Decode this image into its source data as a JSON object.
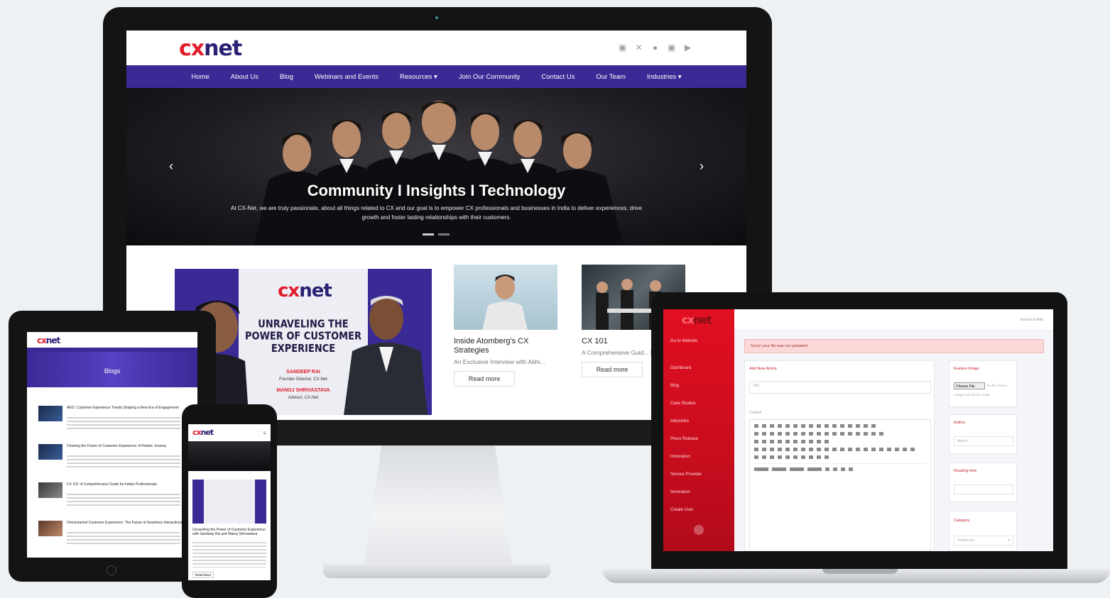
{
  "brand": {
    "logo_cx": "cx",
    "logo_net": "net",
    "accent": "#3a2a96",
    "red": "#e11c2b"
  },
  "desktop": {
    "social_icons": [
      "linkedin-icon",
      "x-icon",
      "facebook-icon",
      "instagram-icon",
      "youtube-icon"
    ],
    "nav": [
      "Home",
      "About Us",
      "Blog",
      "Webinars and Events",
      "Resources ▾",
      "Join Our Community",
      "Contact Us",
      "Our Team",
      "Industries ▾"
    ],
    "hero": {
      "title": "Community I Insights I Technology",
      "description": "At CX-Net, we are truly passionate, about all things related to CX and our goal is to empower CX professionals and businesses in India to deliver experiences, drive growth and foster lasting relationships with their customers."
    },
    "banner": {
      "title": "UNRAVELING THE POWER OF CUSTOMER EXPERIENCE",
      "guest1_name": "SANDEEP RAI",
      "guest1_role": "Founder Director, CX-Net",
      "guest2_name": "MANOJ SHRIVASTAVA",
      "guest2_role": "Advisor, CX-Net"
    },
    "cards": [
      {
        "title": "Inside Atomberg's CX Strategies",
        "desc": "An Exclusive Interview with Abhi...",
        "button": "Read more"
      },
      {
        "title": "CX 101",
        "desc": "A Comprehensive Guid... Professionals",
        "button": "Read more"
      }
    ]
  },
  "laptop": {
    "sidebar": [
      "Go to Website",
      "Dashboard",
      "Blog",
      "Case Studies",
      "Industries",
      "Press Release",
      "Innovation",
      "Service Provider",
      "Innovation",
      "Create User"
    ],
    "top_right": "Search & Help",
    "alert": "Sorry! your file was not uploaded",
    "form_title": "Add New Article",
    "title_label": "Title",
    "content_label": "Content",
    "feature_image_label": "Feature Image",
    "choose_file": "Choose File",
    "no_file": "No file chosen",
    "image_hint": "Images size (below 1MB)",
    "author_label": "Author",
    "author_placeholder": "Author",
    "reading_time_label": "Reading time",
    "category_label": "Category",
    "category_value": "Healthcare"
  },
  "tablet": {
    "page_title": "Blogs",
    "rows": [
      "AEO: Customer Experience Trends Shaping a New Era of Engagement",
      "Charting the Future of Customer Experience: A Holistic Journey",
      "CX 101: A Comprehensive Guide for Indian Professionals",
      "Omnichannel Customer Experience: The Future of Seamless Interactions"
    ]
  },
  "phone": {
    "article_title": "Unraveling the Power of Customer Experience with Sandeep Rai and Manoj Shrivastava",
    "button": "Read More"
  }
}
